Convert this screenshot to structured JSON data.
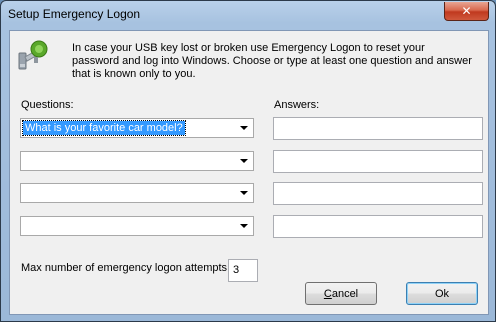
{
  "window": {
    "title": "Setup Emergency Logon",
    "close_glyph": "✕"
  },
  "intro_icon": "usb-key-icon",
  "intro_text": "In case your USB key lost or broken use Emergency Logon to reset your password and log into Windows. Choose or type at least one question and answer that is known only to you.",
  "questions_label": "Questions:",
  "answers_label": "Answers:",
  "questions": [
    {
      "value": "What is your favorite car model?",
      "selected": true
    },
    {
      "value": "",
      "selected": false
    },
    {
      "value": "",
      "selected": false
    },
    {
      "value": "",
      "selected": false
    }
  ],
  "answers": [
    "",
    "",
    "",
    ""
  ],
  "attempts": {
    "label": "Max number of emergency logon attempts:",
    "value": "3"
  },
  "buttons": {
    "cancel_mnemonic": "C",
    "cancel_rest": "ancel",
    "ok": "Ok"
  },
  "colors": {
    "selection": "#3399ff",
    "key_green": "#5aa82a"
  }
}
